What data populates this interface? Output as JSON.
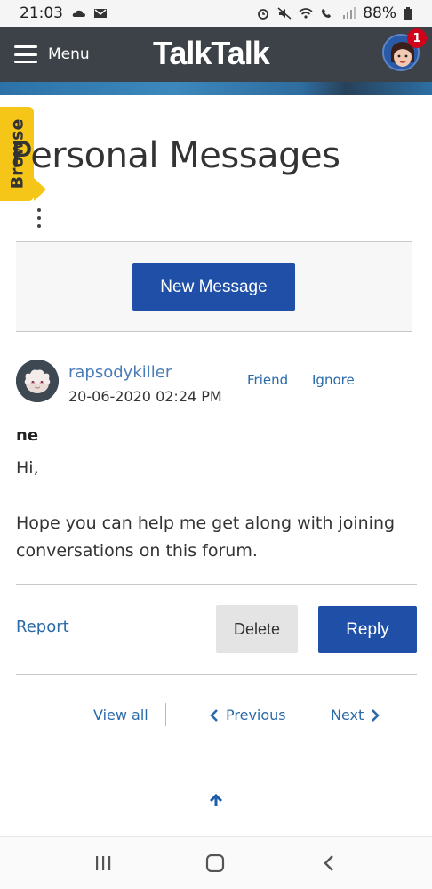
{
  "status_bar": {
    "time": "21:03",
    "battery": "88%"
  },
  "header": {
    "menu_label": "Menu",
    "logo": "TalkTalk",
    "notification_count": "1"
  },
  "browse_tab": {
    "label": "Browse"
  },
  "page": {
    "title": "Personal Messages"
  },
  "actions": {
    "new_message": "New Message"
  },
  "message": {
    "author": "rapsodykiller",
    "date": "20-06-2020 02:24 PM",
    "friend": "Friend",
    "ignore": "Ignore",
    "subject": "ne",
    "greeting": "Hi,",
    "body": "Hope you can help me get along with joining conversations on this forum."
  },
  "message_actions": {
    "report": "Report",
    "delete": "Delete",
    "reply": "Reply"
  },
  "pager": {
    "view_all": "View all",
    "previous": "Previous",
    "next": "Next"
  },
  "colors": {
    "header_bg": "#3c4247",
    "primary_button": "#1f4fa6",
    "link": "#2a6aa8",
    "browse_tab": "#f5c518",
    "badge": "#d0021b"
  }
}
